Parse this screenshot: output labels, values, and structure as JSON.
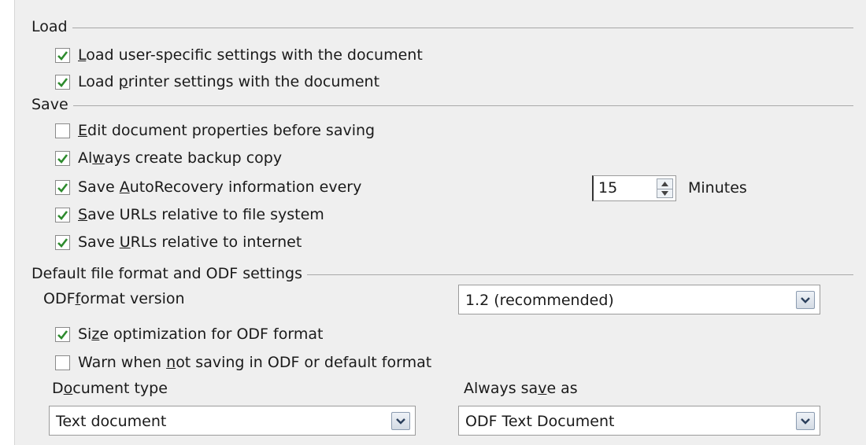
{
  "load": {
    "section_title": "Load",
    "user_settings": {
      "pre": "",
      "ul": "L",
      "post": "oad user-specific settings with the document",
      "checked": true
    },
    "printer_settings": {
      "pre": "Load ",
      "ul": "p",
      "post": "rinter settings with the document",
      "checked": true
    }
  },
  "save": {
    "section_title": "Save",
    "edit_properties": {
      "pre": "",
      "ul": "E",
      "post": "dit document properties before saving",
      "checked": false
    },
    "backup_copy": {
      "pre": "Al",
      "ul": "w",
      "post": "ays create backup copy",
      "checked": true
    },
    "autorecovery": {
      "pre": "Save ",
      "ul": "A",
      "post": "utoRecovery information every",
      "checked": true
    },
    "autorecovery_minutes": "15",
    "minutes_label": "Minutes",
    "urls_file_system": {
      "pre": "",
      "ul": "S",
      "post": "ave URLs relative to file system",
      "checked": true
    },
    "urls_internet": {
      "pre": "Save ",
      "ul": "U",
      "post": "RLs relative to internet",
      "checked": true
    }
  },
  "default_format": {
    "section_title": "Default file format and ODF settings",
    "odf_version_label": {
      "pre": "ODF ",
      "ul": "f",
      "post": "ormat version"
    },
    "odf_version_value": "1.2 (recommended)",
    "size_optimization": {
      "pre": "Si",
      "ul": "z",
      "post": "e optimization for ODF format",
      "checked": true
    },
    "warn_not_odf": {
      "pre": "Warn when ",
      "ul": "n",
      "post": "ot saving in ODF or default format",
      "checked": false
    },
    "document_type_label": {
      "pre": "D",
      "ul": "o",
      "post": "cument type"
    },
    "document_type_value": "Text document",
    "always_save_as_label": {
      "pre": "Always sa",
      "ul": "v",
      "post": "e as"
    },
    "always_save_as_value": "ODF Text Document"
  },
  "colors": {
    "check_green": "#2e8b2e",
    "section_rule": "#a8a8a8"
  }
}
